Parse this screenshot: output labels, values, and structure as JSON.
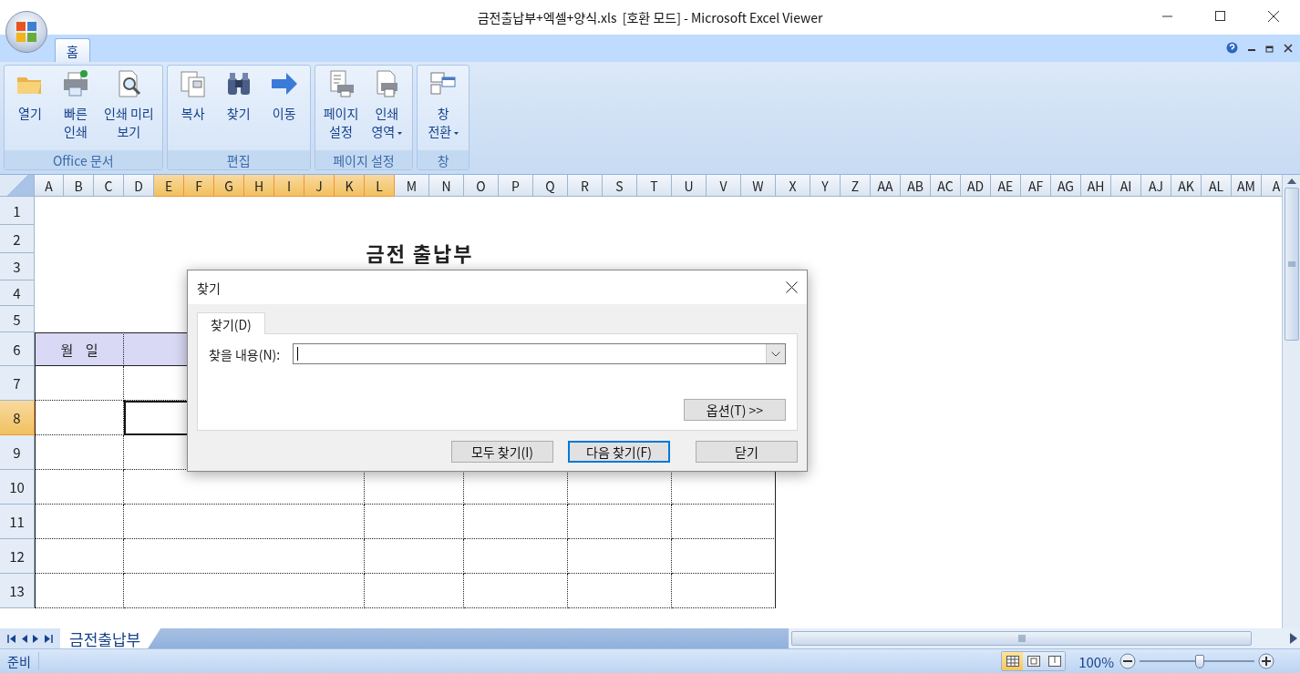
{
  "window": {
    "title": "금전출납부+엑셀+양식.xls  [호환 모드] - Microsoft Excel Viewer"
  },
  "ribbon_tabs": [
    {
      "label": "홈",
      "selected": true
    }
  ],
  "ribbon_groups": [
    {
      "label": "Office 문서",
      "buttons": [
        {
          "lines": [
            "열기"
          ],
          "dropdown": false
        },
        {
          "lines": [
            "빠른",
            "인쇄"
          ],
          "dropdown": false
        },
        {
          "lines": [
            "인쇄 미리",
            "보기"
          ],
          "dropdown": false
        }
      ]
    },
    {
      "label": "편집",
      "buttons": [
        {
          "lines": [
            "복사"
          ],
          "dropdown": false
        },
        {
          "lines": [
            "찾기"
          ],
          "dropdown": false
        },
        {
          "lines": [
            "이동"
          ],
          "dropdown": false
        }
      ]
    },
    {
      "label": "페이지 설정",
      "buttons": [
        {
          "lines": [
            "페이지",
            "설정"
          ],
          "dropdown": false
        },
        {
          "lines": [
            "인쇄",
            "영역"
          ],
          "dropdown": true
        }
      ]
    },
    {
      "label": "창",
      "buttons": [
        {
          "lines": [
            "창",
            "전환"
          ],
          "dropdown": true
        }
      ]
    }
  ],
  "columns": [
    {
      "label": "A",
      "selected": false
    },
    {
      "label": "B",
      "selected": false
    },
    {
      "label": "C",
      "selected": false
    },
    {
      "label": "D",
      "selected": false
    },
    {
      "label": "E",
      "selected": true
    },
    {
      "label": "F",
      "selected": true
    },
    {
      "label": "G",
      "selected": true
    },
    {
      "label": "H",
      "selected": true
    },
    {
      "label": "I",
      "selected": true
    },
    {
      "label": "J",
      "selected": true
    },
    {
      "label": "K",
      "selected": true
    },
    {
      "label": "L",
      "selected": true
    },
    {
      "label": "M",
      "selected": false
    },
    {
      "label": "N",
      "selected": false
    },
    {
      "label": "O",
      "selected": false
    },
    {
      "label": "P",
      "selected": false
    },
    {
      "label": "Q",
      "selected": false
    },
    {
      "label": "R",
      "selected": false
    },
    {
      "label": "S",
      "selected": false
    },
    {
      "label": "T",
      "selected": false
    },
    {
      "label": "U",
      "selected": false
    },
    {
      "label": "V",
      "selected": false
    },
    {
      "label": "W",
      "selected": false
    },
    {
      "label": "X",
      "selected": false
    },
    {
      "label": "Y",
      "selected": false
    },
    {
      "label": "Z",
      "selected": false
    },
    {
      "label": "AA",
      "selected": false
    },
    {
      "label": "AB",
      "selected": false
    },
    {
      "label": "AC",
      "selected": false
    },
    {
      "label": "AD",
      "selected": false
    },
    {
      "label": "AE",
      "selected": false
    },
    {
      "label": "AF",
      "selected": false
    },
    {
      "label": "AG",
      "selected": false
    },
    {
      "label": "AH",
      "selected": false
    },
    {
      "label": "AI",
      "selected": false
    },
    {
      "label": "AJ",
      "selected": false
    },
    {
      "label": "AK",
      "selected": false
    },
    {
      "label": "AL",
      "selected": false
    },
    {
      "label": "AM",
      "selected": false
    },
    {
      "label": "A",
      "selected": false
    }
  ],
  "rows": [
    {
      "label": "1",
      "selected": false
    },
    {
      "label": "2",
      "selected": false
    },
    {
      "label": "3",
      "selected": false
    },
    {
      "label": "4",
      "selected": false
    },
    {
      "label": "5",
      "selected": false
    },
    {
      "label": "6",
      "selected": false
    },
    {
      "label": "7",
      "selected": false
    },
    {
      "label": "8",
      "selected": true
    },
    {
      "label": "9",
      "selected": false
    },
    {
      "label": "10",
      "selected": false
    },
    {
      "label": "11",
      "selected": false
    },
    {
      "label": "12",
      "selected": false
    },
    {
      "label": "13",
      "selected": false
    }
  ],
  "sheet": {
    "title": "금전 출납부",
    "table_header": [
      "월    일"
    ]
  },
  "dialog": {
    "title": "찾기",
    "tabs": [
      {
        "label": "찾기(D)",
        "selected": true
      }
    ],
    "find_label": "찾을 내용(N):",
    "options_button": "옵션(T) >>",
    "buttons": [
      {
        "label": "모두 찾기(I)",
        "default": false
      },
      {
        "label": "다음 찾기(F)",
        "default": true
      },
      {
        "label": "닫기",
        "default": false
      }
    ]
  },
  "sheet_tabs": [
    {
      "label": "금전출납부",
      "selected": true
    }
  ],
  "status_bar": {
    "text": "준비",
    "views": [
      {
        "selected": true
      },
      {
        "selected": false
      },
      {
        "selected": false
      }
    ],
    "zoom": "100%",
    "zoom_slider": {
      "level": 0.52
    }
  }
}
